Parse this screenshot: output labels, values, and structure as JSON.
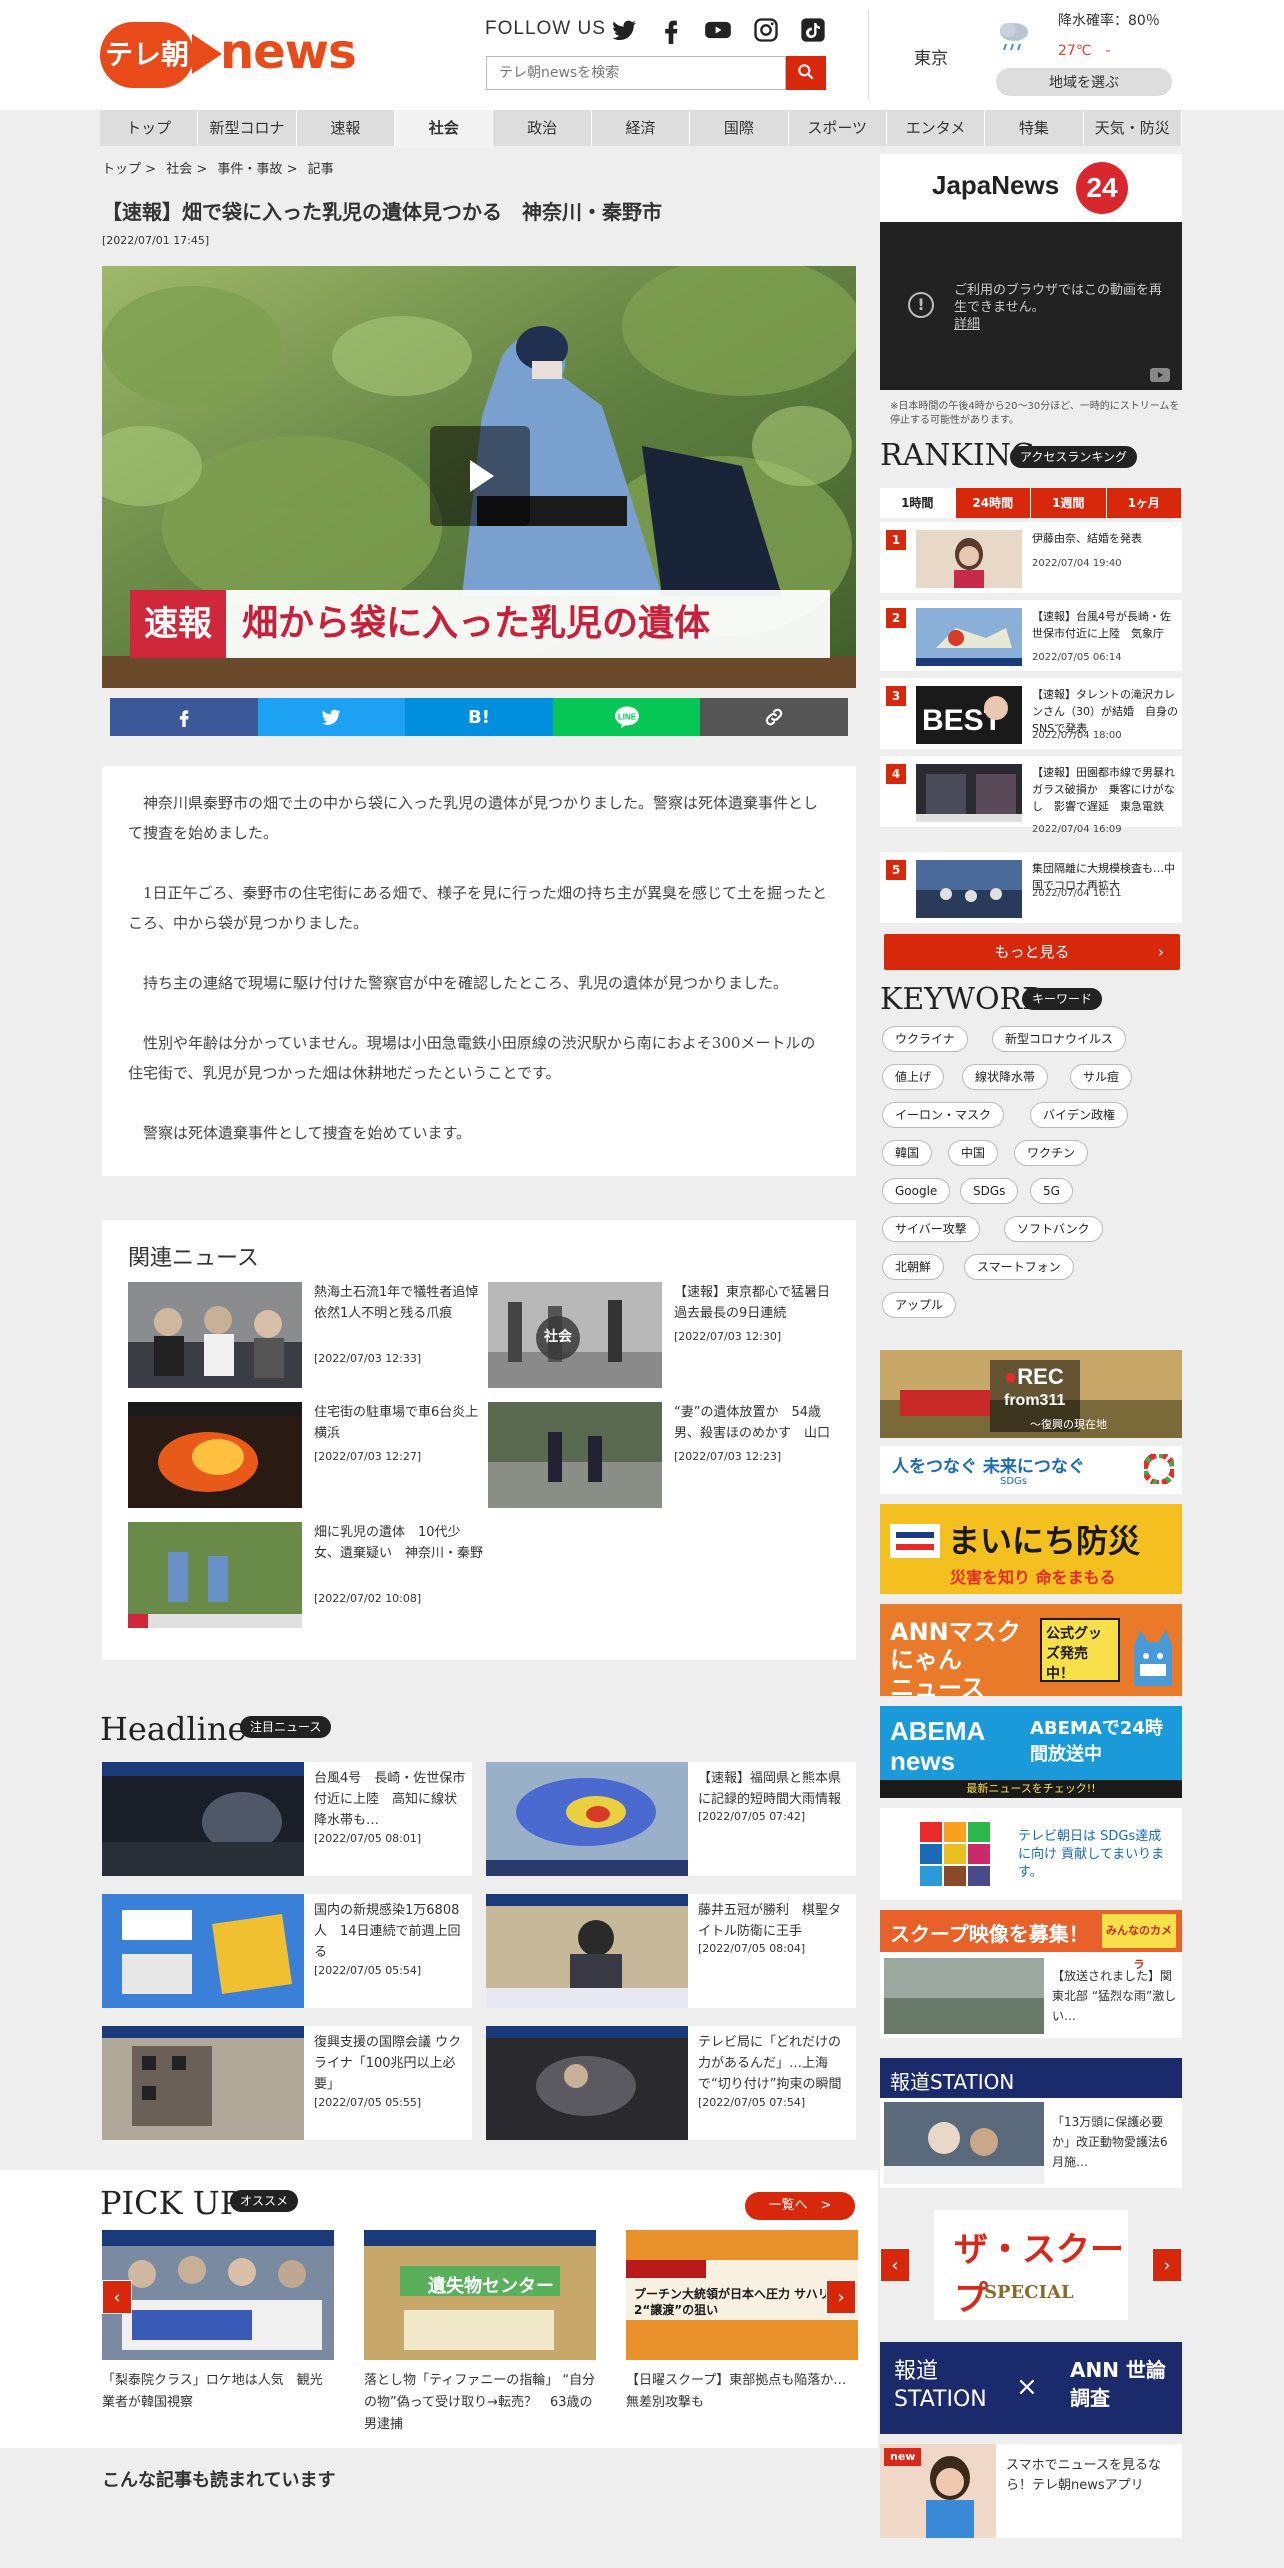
{
  "header": {
    "logo_brand": "テレ朝",
    "logo_word": "news",
    "follow_label": "FOLLOW US",
    "search_placeholder": "テレ朝newsを検索",
    "city": "東京",
    "rain": "降水確率：80％",
    "temp": "27℃　-",
    "region_button": "地域を選ぶ"
  },
  "nav": [
    "トップ",
    "新型コロナ",
    "速報",
    "社会",
    "政治",
    "経済",
    "国際",
    "スポーツ",
    "エンタメ",
    "特集",
    "天気・防災"
  ],
  "breadcrumb": [
    "トップ",
    ">",
    "社会",
    ">",
    "事件・事故",
    ">",
    "記事"
  ],
  "article": {
    "title": "【速報】畑で袋に入った乳児の遺体見つかる　神奈川・秦野市",
    "date": "[2022/07/01 17:45]",
    "video_tag": "速報",
    "video_caption": "畑から袋に入った乳児の遺体",
    "paragraphs": [
      "神奈川県秦野市の畑で土の中から袋に入った乳児の遺体が見つかりました。警察は死体遺棄事件として捜査を始めました。",
      "1日正午ごろ、秦野市の住宅街にある畑で、様子を見に行った畑の持ち主が異臭を感じて土を掘ったところ、中から袋が見つかりました。",
      "持ち主の連絡で現場に駆け付けた警察官が中を確認したところ、乳児の遺体が見つかりました。",
      "性別や年齢は分かっていません。現場は小田急電鉄小田原線の渋沢駅から南におよそ300メートルの住宅街で、乳児が見つかった畑は休耕地だったということです。",
      "警察は死体遺棄事件として捜査を始めています。"
    ]
  },
  "share": {
    "hatena": "B!"
  },
  "related": {
    "title": "関連ニュース",
    "items": [
      {
        "title": "熱海土石流1年で犠牲者追悼　依然1人不明と残る爪痕",
        "date": "[2022/07/03 12:33]"
      },
      {
        "title": "【速報】東京都心で猛暑日　過去最長の9日連続",
        "date": "[2022/07/03 12:30]",
        "thumb_label": "社会"
      },
      {
        "title": "住宅街の駐車場で車6台炎上　横浜",
        "date": "[2022/07/03 12:27]"
      },
      {
        "title": "“妻”の遺体放置か　54歳男、殺害ほのめかす　山口",
        "date": "[2022/07/03 12:23]"
      },
      {
        "title": "畑に乳児の遺体　10代少女、遺棄疑い　神奈川・秦野",
        "date": "[2022/07/02 10:08]"
      }
    ]
  },
  "headline": {
    "title": "Headline",
    "badge": "注目ニュース",
    "items": [
      {
        "title": "台風4号　長崎・佐世保市付近に上陸　高知に線状降水帯も…",
        "date": "[2022/07/05 08:01]"
      },
      {
        "title": "【速報】福岡県と熊本県に記録的短時間大雨情報",
        "date": "[2022/07/05 07:42]"
      },
      {
        "title": "国内の新規感染1万6808人　14日連続で前週上回る",
        "date": "[2022/07/05 05:54]"
      },
      {
        "title": "藤井五冠が勝利　棋聖タイトル防衛に王手",
        "date": "[2022/07/05 08:04]"
      },
      {
        "title": "復興支援の国際会議 ウクライナ「100兆円以上必要」",
        "date": "[2022/07/05 05:55]"
      },
      {
        "title": "テレビ局に「どれだけの力があるんだ」…上海で“切り付け”拘束の瞬間",
        "date": "[2022/07/05 07:54]"
      }
    ]
  },
  "pickup": {
    "title": "PICK UP",
    "badge": "オススメ",
    "more": "一覧へ　>",
    "items": [
      {
        "title": "「梨泰院クラス」ロケ地は人気　観光業者が韓国視察"
      },
      {
        "title": "落とし物「ティファニーの指輪」 “自分の物”偽って受け取り→転売？　63歳の男逮捕",
        "thumb_label": "遺失物センター"
      },
      {
        "title": "【日曜スクープ】東部拠点も陥落か…無差別攻撃も",
        "thumb_label": "プーチン大統領が日本へ圧力 サハリン2“譲渡”の狙い"
      }
    ]
  },
  "also_read": "こんな記事も読まれています",
  "sidebar": {
    "japanews": "JapaNews",
    "japanews_num": "24",
    "video_unavailable": "ご利用のブラウザではこの動画を再生できません。",
    "video_detail": "詳細",
    "stream_note": "※日本時間の午後4時から20～30分ほど、一時的にストリームを停止する可能性があります。",
    "ranking_title": "RANKING",
    "ranking_badge": "アクセスランキング",
    "rank_tabs": [
      "1時間",
      "24時間",
      "1週間",
      "1ヶ月"
    ],
    "rankings": [
      {
        "num": "1",
        "title": "伊藤由奈、結婚を発表",
        "date": "2022/07/04 19:40"
      },
      {
        "num": "2",
        "title": "【速報】台風4号が長崎・佐世保市付近に上陸　気象庁",
        "date": "2022/07/05 06:14"
      },
      {
        "num": "3",
        "title": "【速報】タレントの滝沢カレンさん（30）が結婚　自身のSNSで発表",
        "date": "2022/07/04 18:00"
      },
      {
        "num": "4",
        "title": "【速報】田園都市線で男暴れガラス破損か　乗客にけがなし　影響で遅延　東急電鉄",
        "date": "2022/07/04 16:09"
      },
      {
        "num": "5",
        "title": "集団隔離に大規模検査も…中国でコロナ再拡大",
        "date": "2022/07/04 16:11"
      }
    ],
    "more_button": "もっと見る",
    "keyword_title": "KEYWORD",
    "keyword_badge": "キーワード",
    "keywords": [
      "ウクライナ",
      "新型コロナウイルス",
      "値上げ",
      "線状降水帯",
      "サル痘",
      "イーロン・マスク",
      "バイデン政権",
      "韓国",
      "中国",
      "ワクチン",
      "Google",
      "SDGs",
      "5G",
      "サイバー攻撃",
      "ソフトバンク",
      "北朝鮮",
      "スマートフォン",
      "アップル"
    ],
    "banners": {
      "rec311_line1": "REC",
      "rec311_line2": "from311",
      "rec311_sub": "～復興の現在地",
      "sdgs_main": "人をつなぐ 未来につなぐ",
      "sdgs_small": "SDGs",
      "bousai_main": "まいにち防災",
      "bousai_sub": "災害を知り 命をまもる",
      "mask_line1": "ANNマスクにゃん",
      "mask_line2": "ニュース",
      "mask_goods": "公式グッズ発売中！",
      "abema_logo": "ABEMA news",
      "abema_text": "ABEMAで24時間放送中",
      "abema_sub": "最新ニュースをチェック!!",
      "sdgs2_text": "テレビ朝日は SDGs達成に向け 貢献してまいります。",
      "scoop_title": "スクープ映像を募集！",
      "scoop_logo": "みんなのカメラ",
      "scoop_item": "【放送されました】関東北部 “猛烈な雨”激しい…",
      "station_title": "報道STATION",
      "station_item": "「13万頭に保護必要か」改正動物愛護法6月施…",
      "thescoop_title": "ザ・スクープ",
      "thescoop_sub": "SPECIAL",
      "station2_left": "報道 STATION",
      "station2_x": "×",
      "station2_right": "ANN 世論調査",
      "app_new": "new",
      "app_text": "スマホでニュースを見るなら！テレ朝newsアプリ"
    }
  },
  "colors": {
    "accent": "#d8280c",
    "brand": "#e84a1a",
    "facebook": "#3b5998",
    "twitter": "#1da1f2",
    "hatena": "#008fde",
    "line": "#06c755",
    "link": "#555555"
  }
}
